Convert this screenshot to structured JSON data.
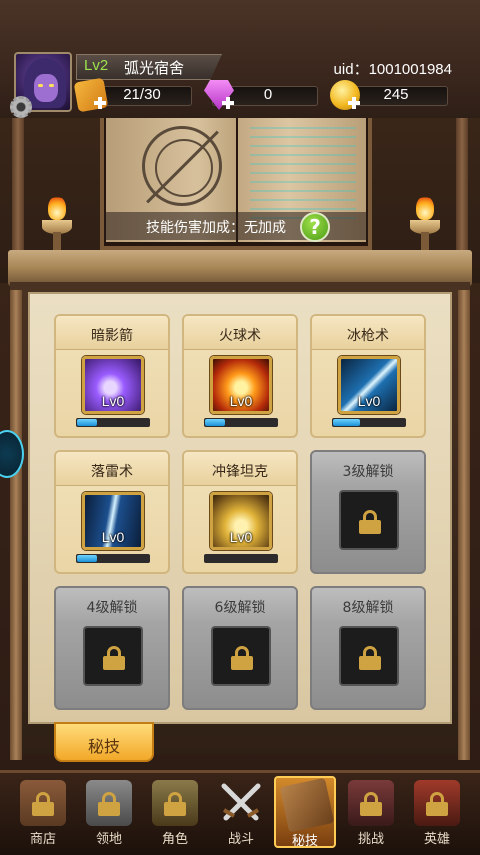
{
  "player": {
    "level": "Lv2",
    "name": "弧光宿舍",
    "uid": "uid：1001001984"
  },
  "resources": {
    "energy": "21/30",
    "gems": "0",
    "gold": "245"
  },
  "book": {
    "bonus_text": "技能伤害加成：无加成",
    "help_label": "?"
  },
  "skills": [
    {
      "name": "暗影箭",
      "level": "Lv0",
      "progress": 0.28,
      "color": "#7a3fd0"
    },
    {
      "name": "火球术",
      "level": "Lv0",
      "progress": 0.28,
      "color": "#e2551a"
    },
    {
      "name": "冰枪术",
      "level": "Lv0",
      "progress": 0.38,
      "color": "#2a9fd8"
    },
    {
      "name": "落雷术",
      "level": "Lv0",
      "progress": 0.28,
      "color": "#1b5e9a"
    },
    {
      "name": "冲锋坦克",
      "level": "Lv0",
      "progress": 0.0,
      "color": "#c78a1a"
    }
  ],
  "locked_slots": [
    {
      "label": "3级解锁"
    },
    {
      "label": "4级解锁"
    },
    {
      "label": "6级解锁"
    },
    {
      "label": "8级解锁"
    }
  ],
  "secret_tab": {
    "label": "秘技"
  },
  "nav": [
    {
      "label": "商店",
      "icon": "shop-icon",
      "locked": true
    },
    {
      "label": "领地",
      "icon": "territory-icon",
      "locked": true
    },
    {
      "label": "角色",
      "icon": "character-icon",
      "locked": true
    },
    {
      "label": "战斗",
      "icon": "battle-icon",
      "locked": false
    },
    {
      "label": "秘技",
      "icon": "secret-skill-icon",
      "locked": false,
      "active": true
    },
    {
      "label": "挑战",
      "icon": "challenge-icon",
      "locked": true
    },
    {
      "label": "英雄",
      "icon": "hero-icon",
      "locked": true
    }
  ]
}
